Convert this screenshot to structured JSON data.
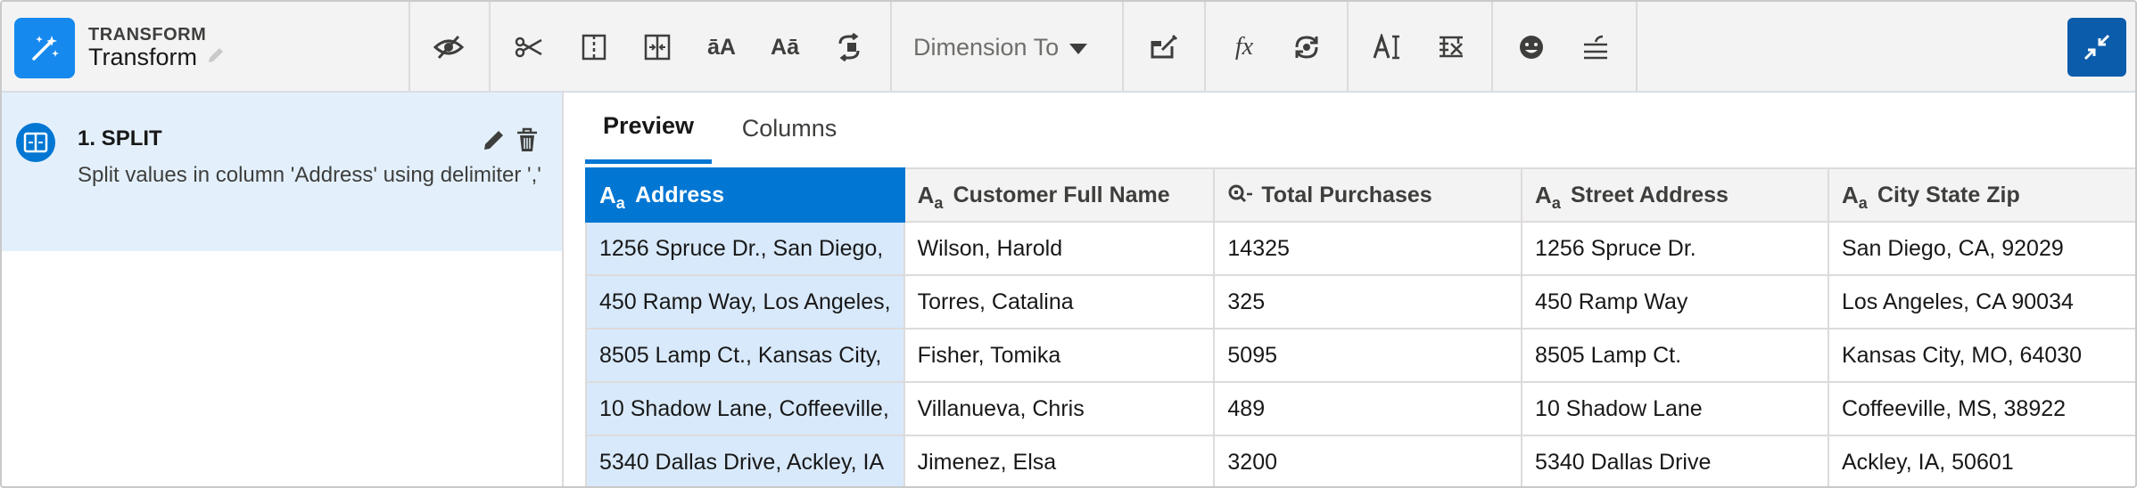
{
  "header": {
    "kicker": "TRANSFORM",
    "title": "Transform",
    "dimension_select": "Dimension To"
  },
  "toolbar": {
    "icons": [
      "drop-columns-icon",
      "split-icon",
      "columns-icon",
      "merge-columns-icon",
      "format-case-icon",
      "edit-attributes-icon",
      "replace-icon",
      "bucket-icon",
      "formula-icon",
      "sync-icon",
      "text-format-icon",
      "clear-values-icon",
      "sentiment-icon",
      "filter-icon"
    ]
  },
  "steps": [
    {
      "title": "1. SPLIT",
      "description": "Split values in column 'Address' using delimiter ','"
    }
  ],
  "tabs": [
    "Preview",
    "Columns"
  ],
  "table": {
    "columns": [
      {
        "label": "Address",
        "type": "text"
      },
      {
        "label": "Customer Full Name",
        "type": "text"
      },
      {
        "label": "Total Purchases",
        "type": "number"
      },
      {
        "label": "Street Address",
        "type": "text"
      },
      {
        "label": "City State Zip",
        "type": "text"
      }
    ],
    "rows": [
      [
        "1256 Spruce Dr., San Diego,",
        "Wilson, Harold",
        "14325",
        "1256 Spruce Dr.",
        "San Diego, CA, 92029"
      ],
      [
        "450 Ramp Way, Los Angeles,",
        "Torres, Catalina",
        "325",
        "450 Ramp Way",
        "Los Angeles, CA 90034"
      ],
      [
        "8505 Lamp Ct., Kansas City,",
        "Fisher, Tomika",
        "5095",
        "8505 Lamp Ct.",
        "Kansas City, MO, 64030"
      ],
      [
        "10 Shadow Lane, Coffeeville,",
        "Villanueva, Chris",
        "489",
        "10 Shadow Lane",
        "Coffeeville, MS, 38922"
      ],
      [
        "5340 Dallas Drive, Ackley, IA",
        "Jimenez, Elsa",
        "3200",
        "5340 Dallas Drive",
        "Ackley, IA, 50601"
      ]
    ]
  },
  "colors": {
    "brand_blue": "#1589ee",
    "accent_blue": "#0176d3",
    "dark_blue": "#0b5cab",
    "selected_cell": "#d8e9fb",
    "step_bg": "#e3f0fc"
  }
}
